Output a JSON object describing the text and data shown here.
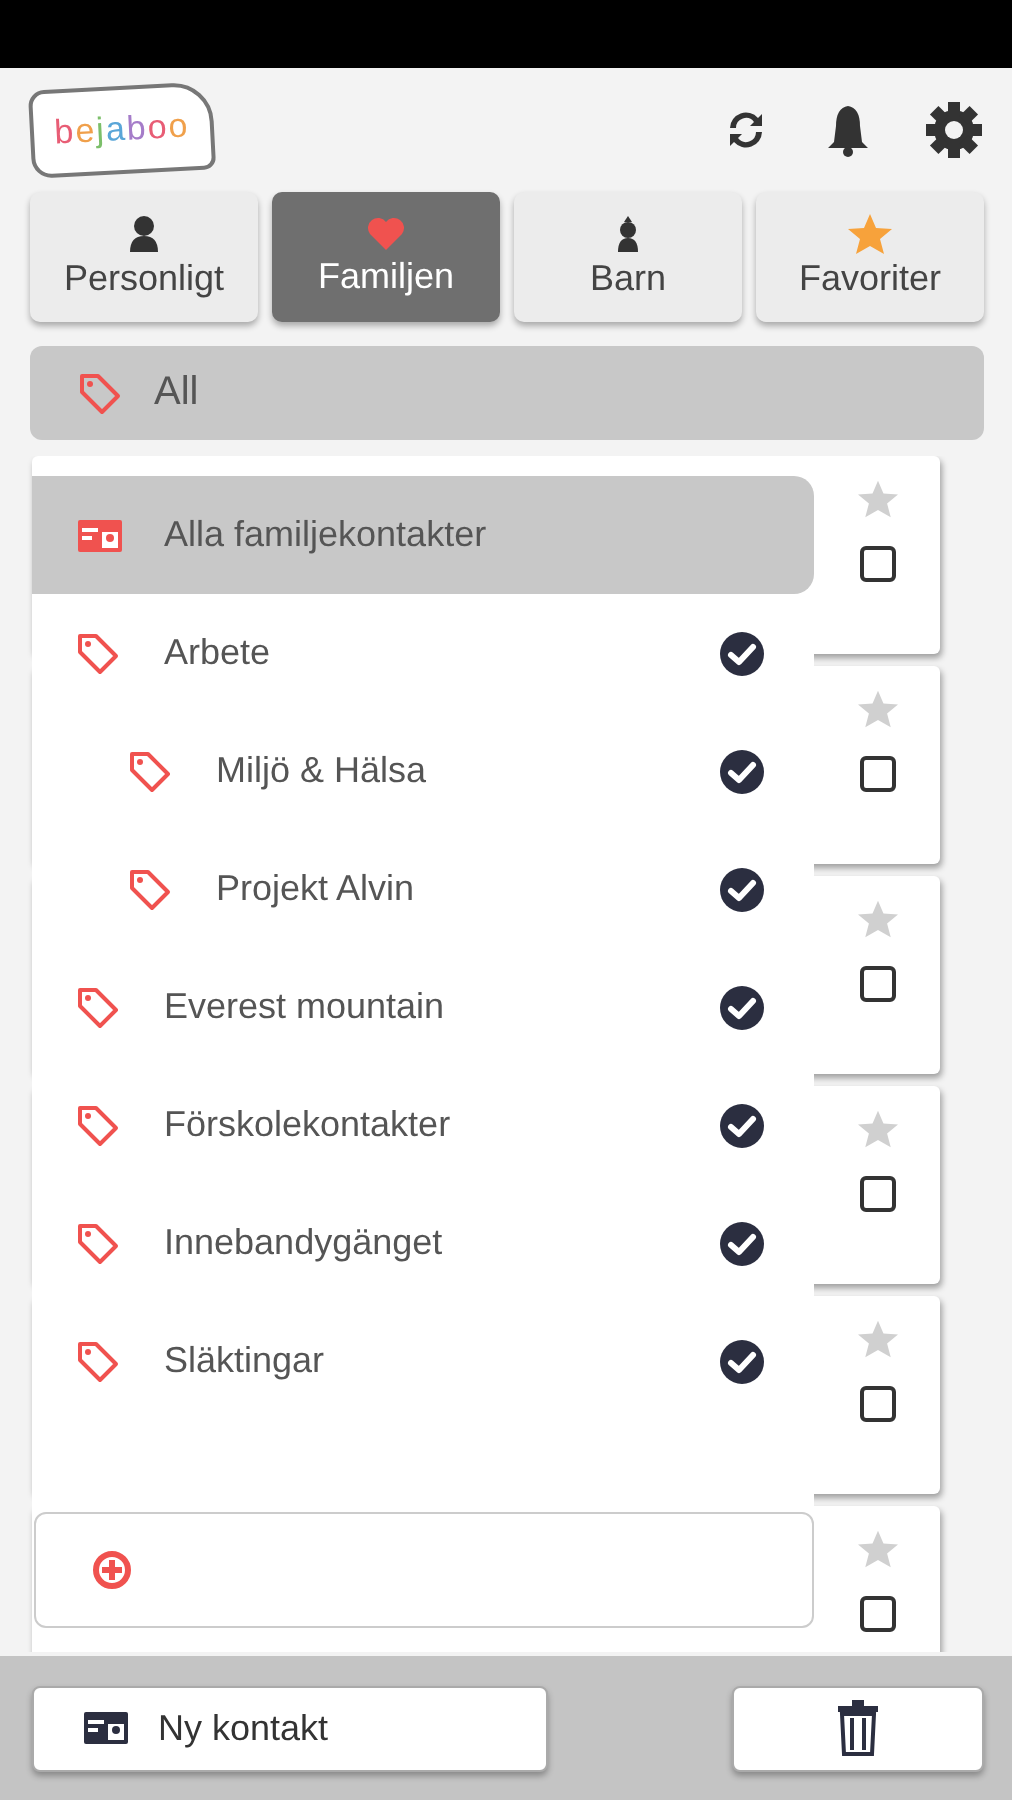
{
  "logo": {
    "text": "bejaboo"
  },
  "tabs": [
    {
      "label": "Personligt",
      "kind": "person",
      "selected": false
    },
    {
      "label": "Familjen",
      "kind": "heart",
      "selected": true
    },
    {
      "label": "Barn",
      "kind": "child",
      "selected": false
    },
    {
      "label": "Favoriter",
      "kind": "star",
      "selected": false
    }
  ],
  "filter": {
    "label": "All"
  },
  "tag_menu": {
    "items": [
      {
        "label": "Alla familjekontakter",
        "kind": "all",
        "selected": true
      },
      {
        "label": "Arbete",
        "kind": "tag",
        "selected": false,
        "checked": true,
        "children": [
          {
            "label": "Miljö & Hälsa",
            "kind": "tag",
            "selected": false,
            "checked": true
          },
          {
            "label": "Projekt Alvin",
            "kind": "tag",
            "selected": false,
            "checked": true
          }
        ]
      },
      {
        "label": "Everest mountain",
        "kind": "tag",
        "selected": false,
        "checked": true
      },
      {
        "label": "Förskolekontakter",
        "kind": "tag",
        "selected": false,
        "checked": true
      },
      {
        "label": "Innebandygänget",
        "kind": "tag",
        "selected": false,
        "checked": true
      },
      {
        "label": "Släktingar",
        "kind": "tag",
        "selected": false,
        "checked": true
      }
    ]
  },
  "contacts": [
    {
      "favorite": false,
      "checked": false
    },
    {
      "favorite": false,
      "checked": false
    },
    {
      "favorite": false,
      "checked": false
    },
    {
      "favorite": false,
      "checked": false
    },
    {
      "favorite": false,
      "checked": false
    },
    {
      "favorite": false,
      "checked": false
    }
  ],
  "bottom_bar": {
    "new_contact": "Ny kontakt"
  }
}
